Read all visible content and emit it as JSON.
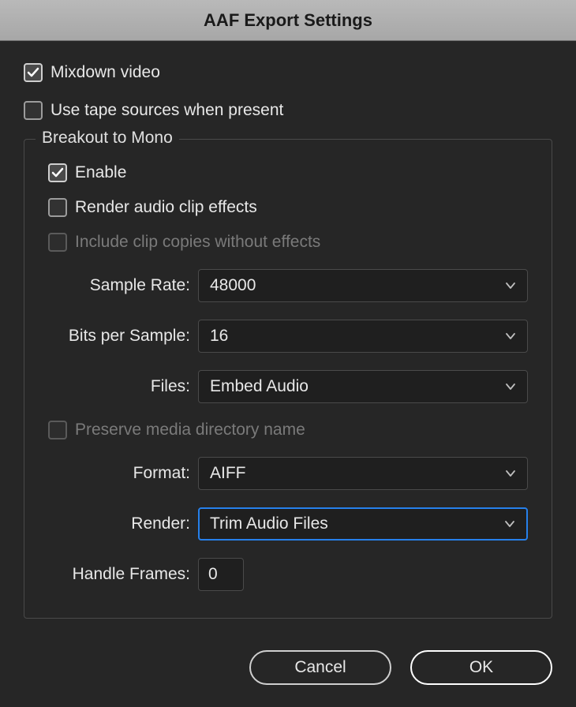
{
  "title": "AAF Export Settings",
  "checkboxes": {
    "mixdown_video": {
      "label": "Mixdown video",
      "checked": true
    },
    "use_tape_sources": {
      "label": "Use tape sources when present",
      "checked": false
    }
  },
  "group": {
    "legend": "Breakout to Mono",
    "enable": {
      "label": "Enable",
      "checked": true
    },
    "render_effects": {
      "label": "Render audio clip effects",
      "checked": false
    },
    "include_copies": {
      "label": "Include clip copies without effects",
      "checked": false,
      "disabled": true
    },
    "sample_rate": {
      "label": "Sample Rate:",
      "value": "48000"
    },
    "bits_per_sample": {
      "label": "Bits per Sample:",
      "value": "16"
    },
    "files": {
      "label": "Files:",
      "value": "Embed Audio"
    },
    "preserve_dir": {
      "label": "Preserve media directory name",
      "checked": false,
      "disabled": true
    },
    "format": {
      "label": "Format:",
      "value": "AIFF"
    },
    "render": {
      "label": "Render:",
      "value": "Trim Audio Files"
    },
    "handle_frames": {
      "label": "Handle Frames:",
      "value": "0"
    }
  },
  "buttons": {
    "cancel": "Cancel",
    "ok": "OK"
  }
}
